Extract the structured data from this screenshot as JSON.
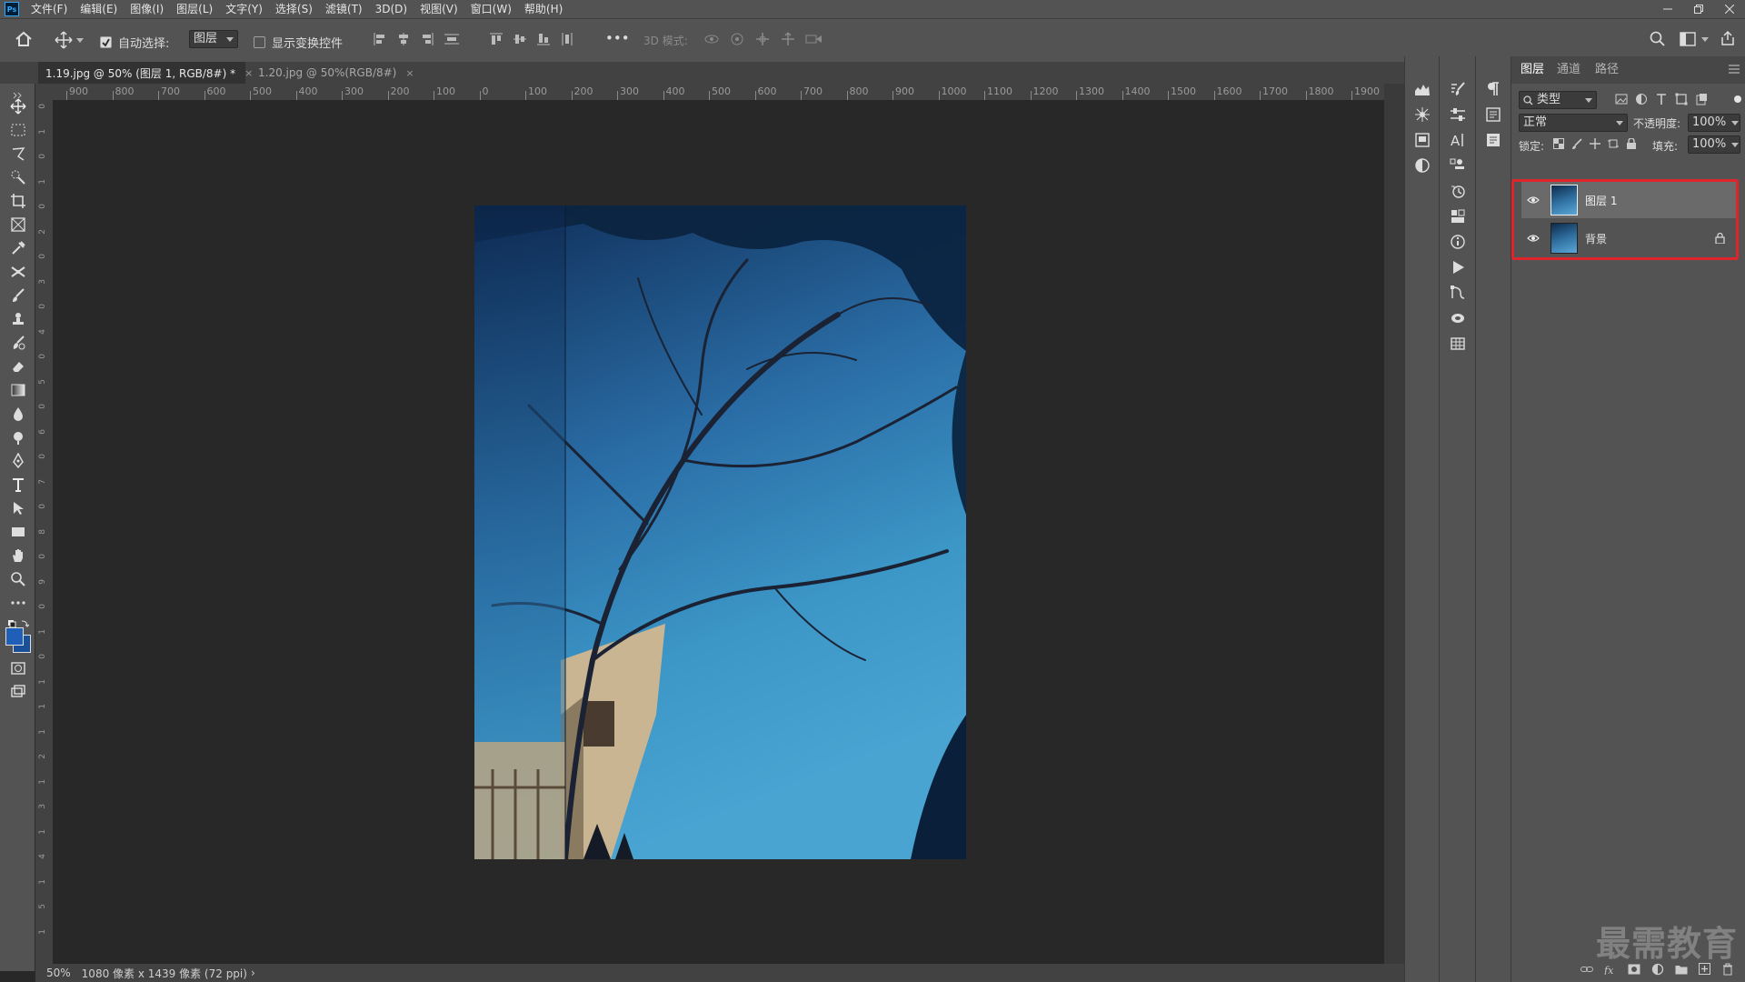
{
  "app": {
    "logo": "Ps"
  },
  "menu": [
    "文件(F)",
    "编辑(E)",
    "图像(I)",
    "图层(L)",
    "文字(Y)",
    "选择(S)",
    "滤镜(T)",
    "3D(D)",
    "视图(V)",
    "窗口(W)",
    "帮助(H)"
  ],
  "options": {
    "auto_select_label": "自动选择:",
    "auto_select_value": "图层",
    "show_transform_label": "显示变换控件",
    "more": "•••",
    "mode_3d_label": "3D 模式:"
  },
  "tabs": [
    {
      "label": "1.19.jpg @ 50% (图层 1, RGB/8#) *",
      "close": "×"
    },
    {
      "label": "1.20.jpg @ 50%(RGB/8#)",
      "close": "×"
    }
  ],
  "ruler_top": [
    "900",
    "800",
    "700",
    "600",
    "500",
    "400",
    "300",
    "200",
    "100",
    "0",
    "100",
    "200",
    "300",
    "400",
    "500",
    "600",
    "700",
    "800",
    "900",
    "1000",
    "1100",
    "1200",
    "1300",
    "1400",
    "1500",
    "1600",
    "1700",
    "1800",
    "1900"
  ],
  "ruler_left": [
    "0",
    "1",
    "0",
    "1",
    "0",
    "2",
    "0",
    "3",
    "0",
    "4",
    "0",
    "5",
    "0",
    "6",
    "0",
    "7",
    "0",
    "8",
    "0",
    "9",
    "0",
    "1",
    "0",
    "1",
    "1",
    "1",
    "2",
    "1",
    "3",
    "1",
    "4",
    "1",
    "5",
    "1"
  ],
  "status": {
    "zoom": "50%",
    "info": "1080 像素 x 1439 像素 (72 ppi)",
    "arrow": "›"
  },
  "layers_panel": {
    "tabs": [
      "图层",
      "通道",
      "路径"
    ],
    "filter_label": "类型",
    "blend_mode": "正常",
    "opacity_label": "不透明度:",
    "opacity_value": "100%",
    "lock_label": "锁定:",
    "fill_label": "填充:",
    "fill_value": "100%",
    "layers": [
      {
        "name": "图层 1",
        "selected": true,
        "locked": false
      },
      {
        "name": "背景",
        "selected": false,
        "locked": true
      }
    ]
  },
  "watermark": "最需教育",
  "colors": {
    "highlight": "#e0242b",
    "foreground": "#1f5fb8",
    "background": "#1a4f9a"
  }
}
